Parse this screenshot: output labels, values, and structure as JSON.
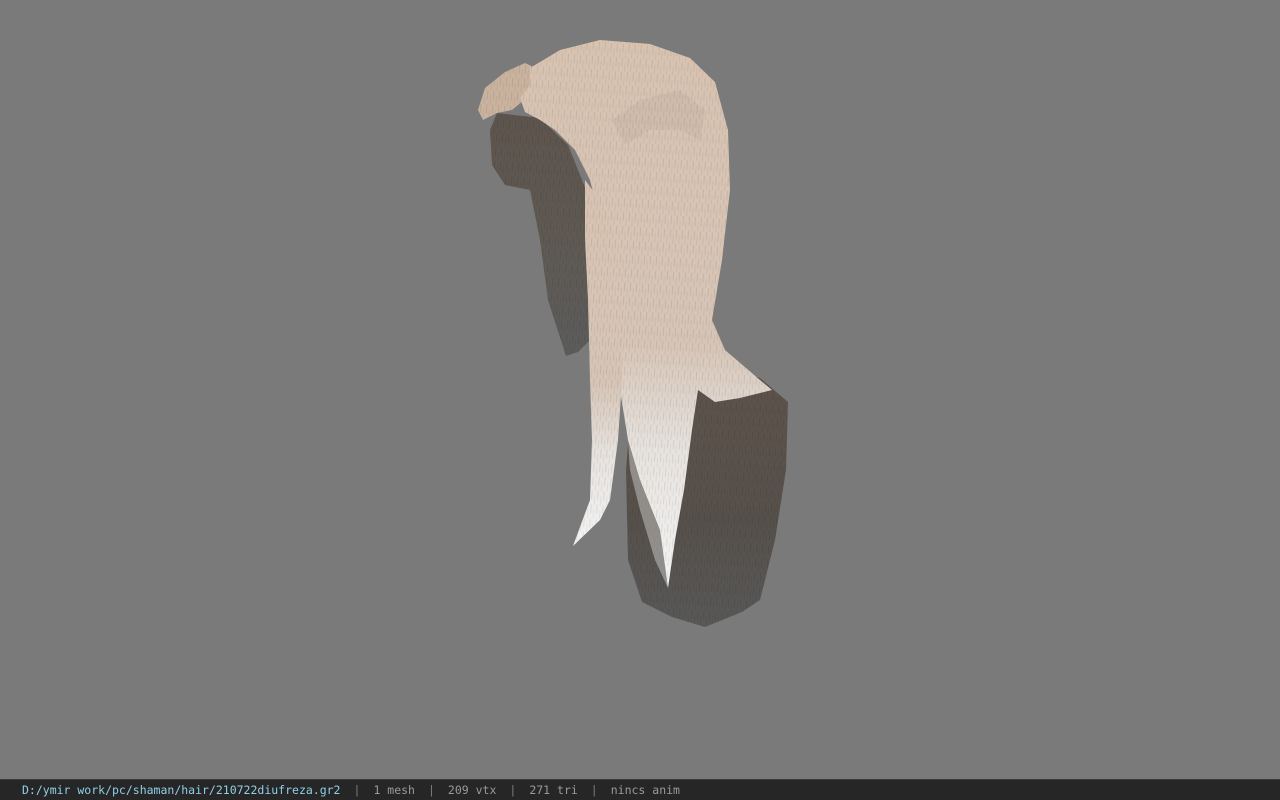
{
  "viewport": {
    "background_color": "#7a7a7a",
    "model": "hair-mesh"
  },
  "statusbar": {
    "file_path": "D:/ymir work/pc/shaman/hair/210722diufreza.gr2",
    "separator": "|",
    "mesh_count": "1 mesh",
    "vertex_count": "209 vtx",
    "triangle_count": "271 tri",
    "animation": "nincs anim",
    "path_color": "#8fd0e8",
    "text_color": "#9a9a9a"
  }
}
